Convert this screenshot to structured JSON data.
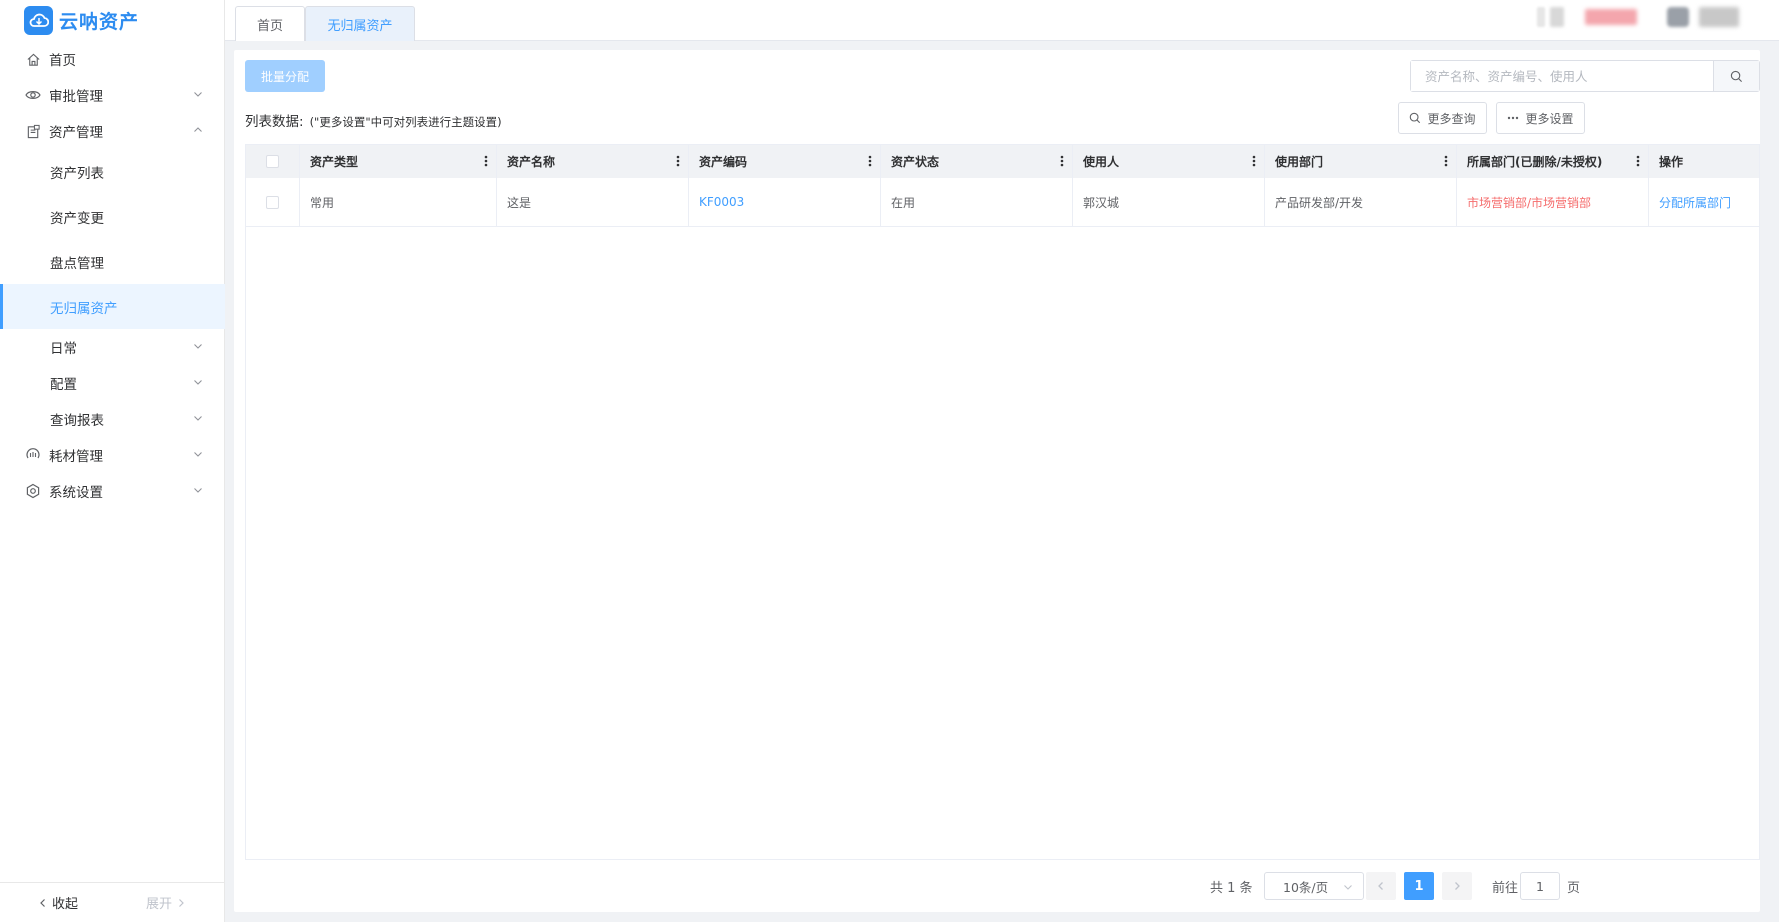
{
  "app": {
    "name": "云呐资产",
    "accent": "#409eff"
  },
  "sidebar": {
    "items": [
      {
        "label": "首页",
        "icon": "home-icon"
      },
      {
        "label": "审批管理",
        "icon": "eye-icon"
      },
      {
        "label": "资产管理",
        "icon": "asset-icon"
      },
      {
        "label": "资产列表"
      },
      {
        "label": "资产变更"
      },
      {
        "label": "盘点管理"
      },
      {
        "label": "无归属资产",
        "active": true
      },
      {
        "label": "日常"
      },
      {
        "label": "配置"
      },
      {
        "label": "查询报表"
      },
      {
        "label": "耗材管理",
        "icon": "consumable-icon"
      },
      {
        "label": "系统设置",
        "icon": "gear-icon"
      }
    ],
    "collapse_label": "收起",
    "expand_label": "展开"
  },
  "tabs": [
    {
      "label": "首页"
    },
    {
      "label": "无归属资产",
      "active": true
    }
  ],
  "toolbar": {
    "batch_assign_label": "批量分配",
    "search_placeholder": "资产名称、资产编号、使用人",
    "list_label": "列表数据:",
    "list_hint": "(\"更多设置\"中可对列表进行主题设置)",
    "more_query_label": "更多查询",
    "more_settings_label": "更多设置"
  },
  "table": {
    "columns": [
      "资产类型",
      "资产名称",
      "资产编码",
      "资产状态",
      "使用人",
      "使用部门",
      "所属部门(已删除/未授权)",
      "操作"
    ],
    "rows": [
      [
        "常用",
        "这是",
        "KF0003",
        "在用",
        "郭汉城",
        "产品研发部/开发",
        "市场营销部/市场营销部",
        "分配所属部门"
      ]
    ]
  },
  "pagination": {
    "total_text": "共 1 条",
    "page_size": "10条/页",
    "current_page": "1",
    "goto_label": "前往",
    "goto_value": "1",
    "page_unit": "页"
  }
}
